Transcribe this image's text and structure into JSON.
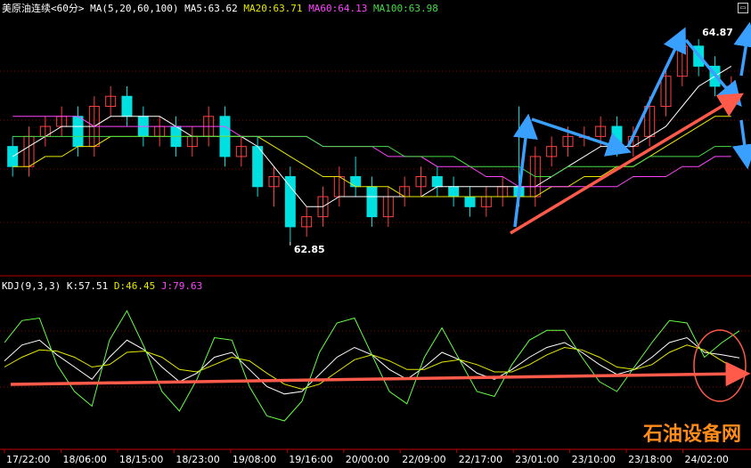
{
  "header": {
    "instrument": "美原油连续",
    "period": "<60分>",
    "ma_label": "MA(5,20,60,100)",
    "ma5": "MA5:63.62",
    "ma20": "MA20:63.71",
    "ma60": "MA60:64.13",
    "ma100": "MA100:63.98"
  },
  "kdj_header": {
    "label": "KDJ(9,3,3)",
    "k": "K:57.51",
    "d": "D:46.45",
    "j": "J:79.63"
  },
  "colors": {
    "up": "#ff4040",
    "down": "#00e0e0",
    "ma5": "#ffffff",
    "ma20": "#e8e800",
    "ma60": "#ff44ff",
    "ma100": "#44dd44",
    "grid": "#8b0000",
    "axis": "#c00000",
    "arrow_blue": "#3aa0ff",
    "arrow_red": "#ff5a4a"
  },
  "watermark": "石油设备网",
  "chart_data": [
    {
      "type": "candlestick",
      "title": "美原油连续 <60分>",
      "ylim": [
        62.6,
        65.1
      ],
      "annotations": [
        {
          "text": "64.87",
          "value": 64.87,
          "kind": "high"
        },
        {
          "text": "62.85",
          "value": 62.85,
          "kind": "low"
        }
      ],
      "x_ticks": [
        "17/22:00",
        "18/06:00",
        "18/15:00",
        "18/23:00",
        "19/08:00",
        "19/16:00",
        "20/00:00",
        "22/09:00",
        "22/17:00",
        "23/01:00",
        "23/10:00",
        "23/18:00",
        "24/02:00"
      ],
      "candles": [
        [
          63.8,
          63.9,
          63.5,
          63.6
        ],
        [
          63.6,
          64.0,
          63.5,
          63.9
        ],
        [
          63.9,
          64.1,
          63.8,
          64.0
        ],
        [
          64.0,
          64.2,
          63.9,
          64.1
        ],
        [
          64.1,
          64.2,
          63.7,
          63.8
        ],
        [
          63.8,
          64.3,
          63.7,
          64.2
        ],
        [
          64.2,
          64.4,
          64.1,
          64.3
        ],
        [
          64.3,
          64.4,
          64.0,
          64.1
        ],
        [
          64.1,
          64.2,
          63.8,
          63.9
        ],
        [
          63.9,
          64.1,
          63.8,
          64.0
        ],
        [
          64.0,
          64.1,
          63.7,
          63.8
        ],
        [
          63.8,
          64.0,
          63.7,
          63.9
        ],
        [
          63.9,
          64.2,
          63.8,
          64.1
        ],
        [
          64.1,
          64.2,
          63.6,
          63.7
        ],
        [
          63.7,
          63.9,
          63.6,
          63.8
        ],
        [
          63.8,
          63.9,
          63.3,
          63.4
        ],
        [
          63.4,
          63.6,
          63.2,
          63.5
        ],
        [
          63.5,
          63.6,
          62.85,
          63.0
        ],
        [
          63.0,
          63.2,
          62.9,
          63.1
        ],
        [
          63.1,
          63.4,
          63.0,
          63.3
        ],
        [
          63.3,
          63.6,
          63.2,
          63.5
        ],
        [
          63.5,
          63.7,
          63.3,
          63.4
        ],
        [
          63.4,
          63.5,
          63.0,
          63.1
        ],
        [
          63.1,
          63.4,
          63.0,
          63.3
        ],
        [
          63.3,
          63.5,
          63.2,
          63.4
        ],
        [
          63.4,
          63.6,
          63.3,
          63.5
        ],
        [
          63.5,
          63.6,
          63.3,
          63.4
        ],
        [
          63.4,
          63.5,
          63.2,
          63.3
        ],
        [
          63.3,
          63.4,
          63.1,
          63.2
        ],
        [
          63.2,
          63.4,
          63.1,
          63.3
        ],
        [
          63.3,
          63.5,
          63.2,
          63.4
        ],
        [
          63.4,
          64.2,
          63.2,
          63.3
        ],
        [
          63.3,
          63.8,
          63.2,
          63.7
        ],
        [
          63.7,
          63.9,
          63.6,
          63.8
        ],
        [
          63.8,
          64.0,
          63.7,
          63.9
        ],
        [
          63.9,
          64.0,
          63.8,
          63.9
        ],
        [
          63.9,
          64.1,
          63.8,
          64.0
        ],
        [
          64.0,
          64.1,
          63.7,
          63.8
        ],
        [
          63.8,
          64.0,
          63.7,
          63.9
        ],
        [
          63.9,
          64.3,
          63.8,
          64.2
        ],
        [
          64.2,
          64.6,
          64.1,
          64.5
        ],
        [
          64.5,
          64.9,
          64.4,
          64.8
        ],
        [
          64.8,
          64.87,
          64.5,
          64.6
        ],
        [
          64.6,
          64.7,
          64.3,
          64.4
        ],
        [
          64.4,
          64.5,
          64.3,
          64.4
        ]
      ],
      "series": [
        {
          "name": "MA5",
          "values": [
            63.7,
            63.8,
            63.9,
            64.0,
            64.0,
            64.0,
            64.1,
            64.1,
            64.1,
            64.1,
            64.0,
            63.9,
            63.9,
            63.9,
            63.9,
            63.8,
            63.6,
            63.4,
            63.2,
            63.2,
            63.3,
            63.3,
            63.3,
            63.3,
            63.3,
            63.3,
            63.4,
            63.4,
            63.4,
            63.4,
            63.4,
            63.4,
            63.4,
            63.5,
            63.6,
            63.7,
            63.8,
            63.8,
            63.8,
            63.9,
            64.0,
            64.2,
            64.4,
            64.5,
            64.6
          ]
        },
        {
          "name": "MA20",
          "values": [
            63.6,
            63.6,
            63.7,
            63.7,
            63.8,
            63.8,
            63.9,
            63.9,
            63.9,
            63.9,
            63.9,
            63.9,
            63.9,
            63.9,
            63.9,
            63.9,
            63.8,
            63.7,
            63.6,
            63.5,
            63.5,
            63.4,
            63.4,
            63.4,
            63.3,
            63.3,
            63.3,
            63.3,
            63.3,
            63.3,
            63.3,
            63.3,
            63.3,
            63.4,
            63.4,
            63.5,
            63.5,
            63.6,
            63.6,
            63.7,
            63.8,
            63.9,
            64.0,
            64.1,
            64.1
          ]
        },
        {
          "name": "MA60",
          "values": [
            64.1,
            64.1,
            64.1,
            64.1,
            64.1,
            64.0,
            64.0,
            64.0,
            64.0,
            64.0,
            64.0,
            64.0,
            64.0,
            64.0,
            63.9,
            63.9,
            63.9,
            63.9,
            63.9,
            63.8,
            63.8,
            63.8,
            63.8,
            63.7,
            63.7,
            63.7,
            63.6,
            63.6,
            63.6,
            63.5,
            63.5,
            63.4,
            63.4,
            63.4,
            63.4,
            63.4,
            63.4,
            63.4,
            63.5,
            63.5,
            63.5,
            63.6,
            63.6,
            63.7,
            63.7
          ]
        },
        {
          "name": "MA100",
          "values": [
            63.9,
            63.9,
            63.9,
            63.9,
            63.9,
            63.9,
            63.9,
            63.9,
            63.9,
            63.9,
            63.9,
            63.9,
            63.9,
            63.9,
            63.9,
            63.9,
            63.9,
            63.9,
            63.9,
            63.8,
            63.8,
            63.8,
            63.8,
            63.8,
            63.7,
            63.7,
            63.7,
            63.7,
            63.6,
            63.6,
            63.6,
            63.6,
            63.5,
            63.5,
            63.6,
            63.6,
            63.6,
            63.6,
            63.6,
            63.7,
            63.7,
            63.7,
            63.7,
            63.8,
            63.8
          ]
        }
      ]
    },
    {
      "type": "line",
      "title": "KDJ(9,3,3)",
      "ylim": [
        -10,
        110
      ],
      "series": [
        {
          "name": "K",
          "values": [
            55,
            68,
            72,
            60,
            50,
            40,
            58,
            72,
            64,
            50,
            38,
            45,
            58,
            62,
            48,
            34,
            28,
            30,
            44,
            58,
            66,
            60,
            48,
            40,
            50,
            62,
            56,
            45,
            40,
            48,
            58,
            66,
            70,
            62,
            52,
            44,
            48,
            58,
            70,
            74,
            62,
            60,
            57.51
          ]
        },
        {
          "name": "D",
          "values": [
            50,
            58,
            64,
            63,
            58,
            50,
            52,
            62,
            63,
            58,
            48,
            46,
            52,
            58,
            55,
            45,
            36,
            32,
            36,
            46,
            56,
            60,
            55,
            48,
            48,
            54,
            56,
            52,
            46,
            46,
            52,
            60,
            66,
            64,
            58,
            50,
            48,
            52,
            62,
            68,
            64,
            55,
            46.45
          ]
        },
        {
          "name": "J",
          "values": [
            70,
            88,
            90,
            52,
            30,
            18,
            72,
            96,
            66,
            30,
            14,
            40,
            74,
            72,
            34,
            10,
            6,
            22,
            62,
            86,
            90,
            60,
            30,
            20,
            58,
            82,
            56,
            30,
            26,
            52,
            72,
            80,
            80,
            58,
            38,
            30,
            50,
            70,
            88,
            86,
            58,
            70,
            79.63
          ]
        }
      ]
    }
  ]
}
